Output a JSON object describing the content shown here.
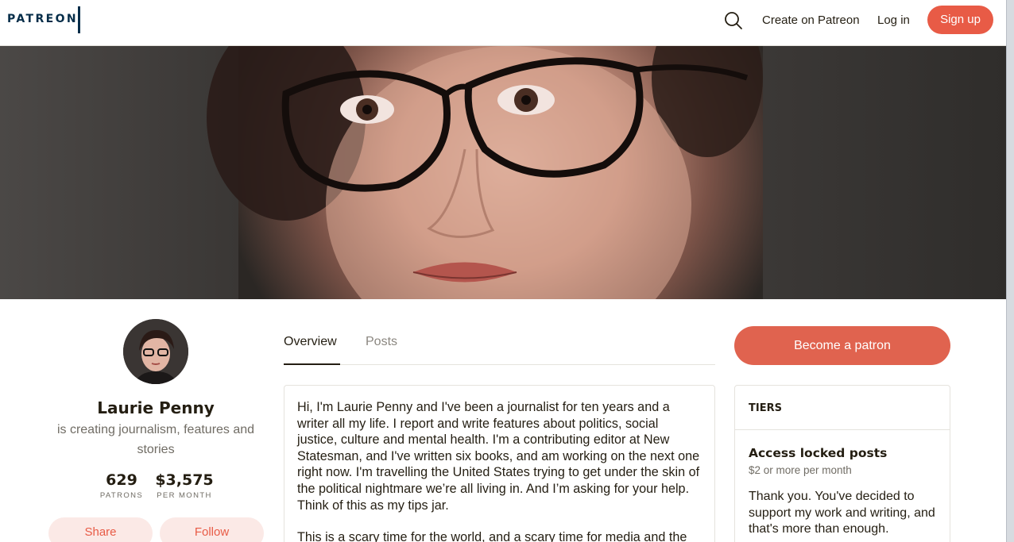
{
  "header": {
    "logo": "PATREON",
    "create_label": "Create on Patreon",
    "login_label": "Log in",
    "signup_label": "Sign up",
    "search_icon": "search-icon"
  },
  "profile": {
    "name": "Laurie Penny",
    "tagline": "is creating journalism, features and stories",
    "patrons_count": "629",
    "patrons_label": "PATRONS",
    "monthly_amount": "$3,575",
    "monthly_label": "PER MONTH",
    "share_label": "Share",
    "follow_label": "Follow"
  },
  "tabs": [
    {
      "label": "Overview",
      "active": true
    },
    {
      "label": "Posts",
      "active": false
    }
  ],
  "about": {
    "paragraphs": [
      "Hi, I'm Laurie Penny and I've been a journalist for ten years and a writer all my life. I report and write features about politics, social justice, culture and mental health. I'm a contributing editor at New Statesman, and I've written six books, and am working on the next one right now. I'm travelling the United States trying to get under the skin of the political nightmare we’re all living in. And I’m asking for your help. Think of this as my tips jar.",
      "This is a scary time for the world, and a scary time for media and the"
    ]
  },
  "sidebar": {
    "become_patron_label": "Become a patron",
    "tiers_heading": "TIERS",
    "tier": {
      "title": "Access locked posts",
      "price": "$2 or more per month",
      "description": "Thank you. You've decided to support my work and writing, and that's more than enough."
    }
  },
  "colors": {
    "brand_coral": "#e85b46",
    "navy": "#052d49",
    "text": "#241e12",
    "muted": "#706c64"
  }
}
